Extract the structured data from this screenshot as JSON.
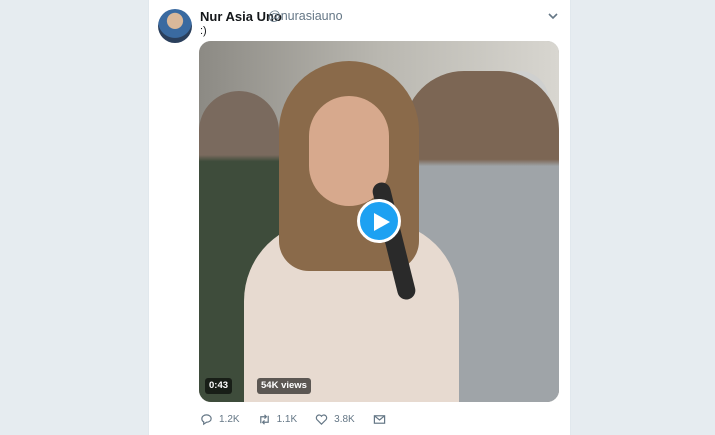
{
  "tweet": {
    "author_name": "Nur Asia Uno",
    "author_handle": "@nurasiauno",
    "text": ":)"
  },
  "video": {
    "duration": "0:43",
    "views": "54K views"
  },
  "actions": {
    "replies": "1.2K",
    "retweets": "1.1K",
    "likes": "3.8K"
  },
  "colors": {
    "accent": "#1da1f2",
    "background": "#e6ecf0",
    "secondary_text": "#657786"
  },
  "icons": [
    "chevron-down-icon",
    "play-icon",
    "reply-icon",
    "retweet-icon",
    "like-icon",
    "message-icon"
  ]
}
